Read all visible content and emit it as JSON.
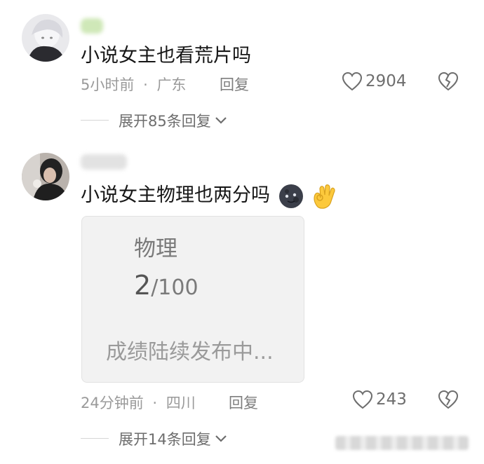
{
  "comments": [
    {
      "text": "小说女主也看荒片吗",
      "time": "5小时前",
      "location": "广东",
      "separator": "·",
      "reply_label": "回复",
      "likes": "2904",
      "expand_label": "展开85条回复"
    },
    {
      "text": "小说女主物理也两分吗",
      "emojis": [
        "moon-face-icon",
        "ok-hand-icon"
      ],
      "time": "24分钟前",
      "location": "四川",
      "separator": "·",
      "reply_label": "回复",
      "likes": "243",
      "expand_label": "展开14条回复",
      "image_card": {
        "subject": "物理",
        "score_main": "2",
        "score_rest": "/100",
        "status": "成绩陆续发布中..."
      }
    }
  ],
  "colors": {
    "text": "#161616",
    "meta": "#9a9a9a",
    "card_bg": "#f2f2f2"
  }
}
